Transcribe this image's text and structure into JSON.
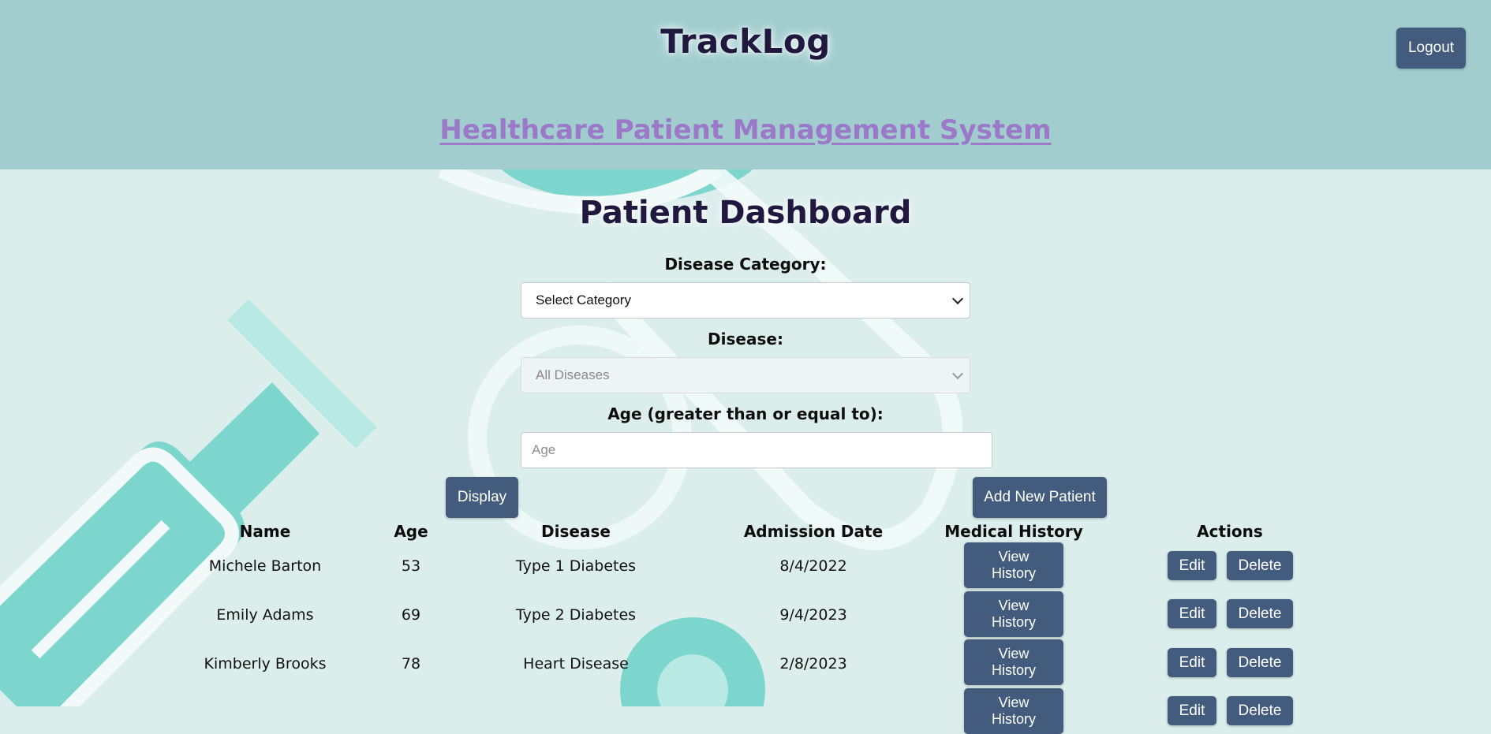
{
  "header": {
    "brand": "TrackLog",
    "subtitle": "Healthcare Patient Management System",
    "logout_label": "Logout"
  },
  "dashboard": {
    "title": "Patient Dashboard",
    "filters": {
      "category_label": "Disease Category:",
      "category_value": "Select Category",
      "disease_label": "Disease:",
      "disease_value": "All Diseases",
      "age_label": "Age (greater than or equal to):",
      "age_placeholder": "Age"
    },
    "display_label": "Display",
    "add_label": "Add New Patient"
  },
  "table": {
    "columns": [
      "Name",
      "Age",
      "Disease",
      "Admission Date",
      "Medical History",
      "Actions"
    ],
    "history_label_line1": "View",
    "history_label_line2": "History",
    "edit_label": "Edit",
    "delete_label": "Delete",
    "rows": [
      {
        "name": "Michele Barton",
        "age": "53",
        "disease": "Type 1 Diabetes",
        "admission": "8/4/2022"
      },
      {
        "name": "Emily Adams",
        "age": "69",
        "disease": "Type 2 Diabetes",
        "admission": "9/4/2023"
      },
      {
        "name": "Kimberly Brooks",
        "age": "78",
        "disease": "Heart Disease",
        "admission": "2/8/2023"
      }
    ]
  },
  "colors": {
    "header_bg": "#a1cdcf",
    "page_bg": "#dbeeec",
    "button": "#435c7d",
    "title_text": "#21183f",
    "subtitle_link": "#9b79c8",
    "accent_teal": "#7dd6cd"
  }
}
